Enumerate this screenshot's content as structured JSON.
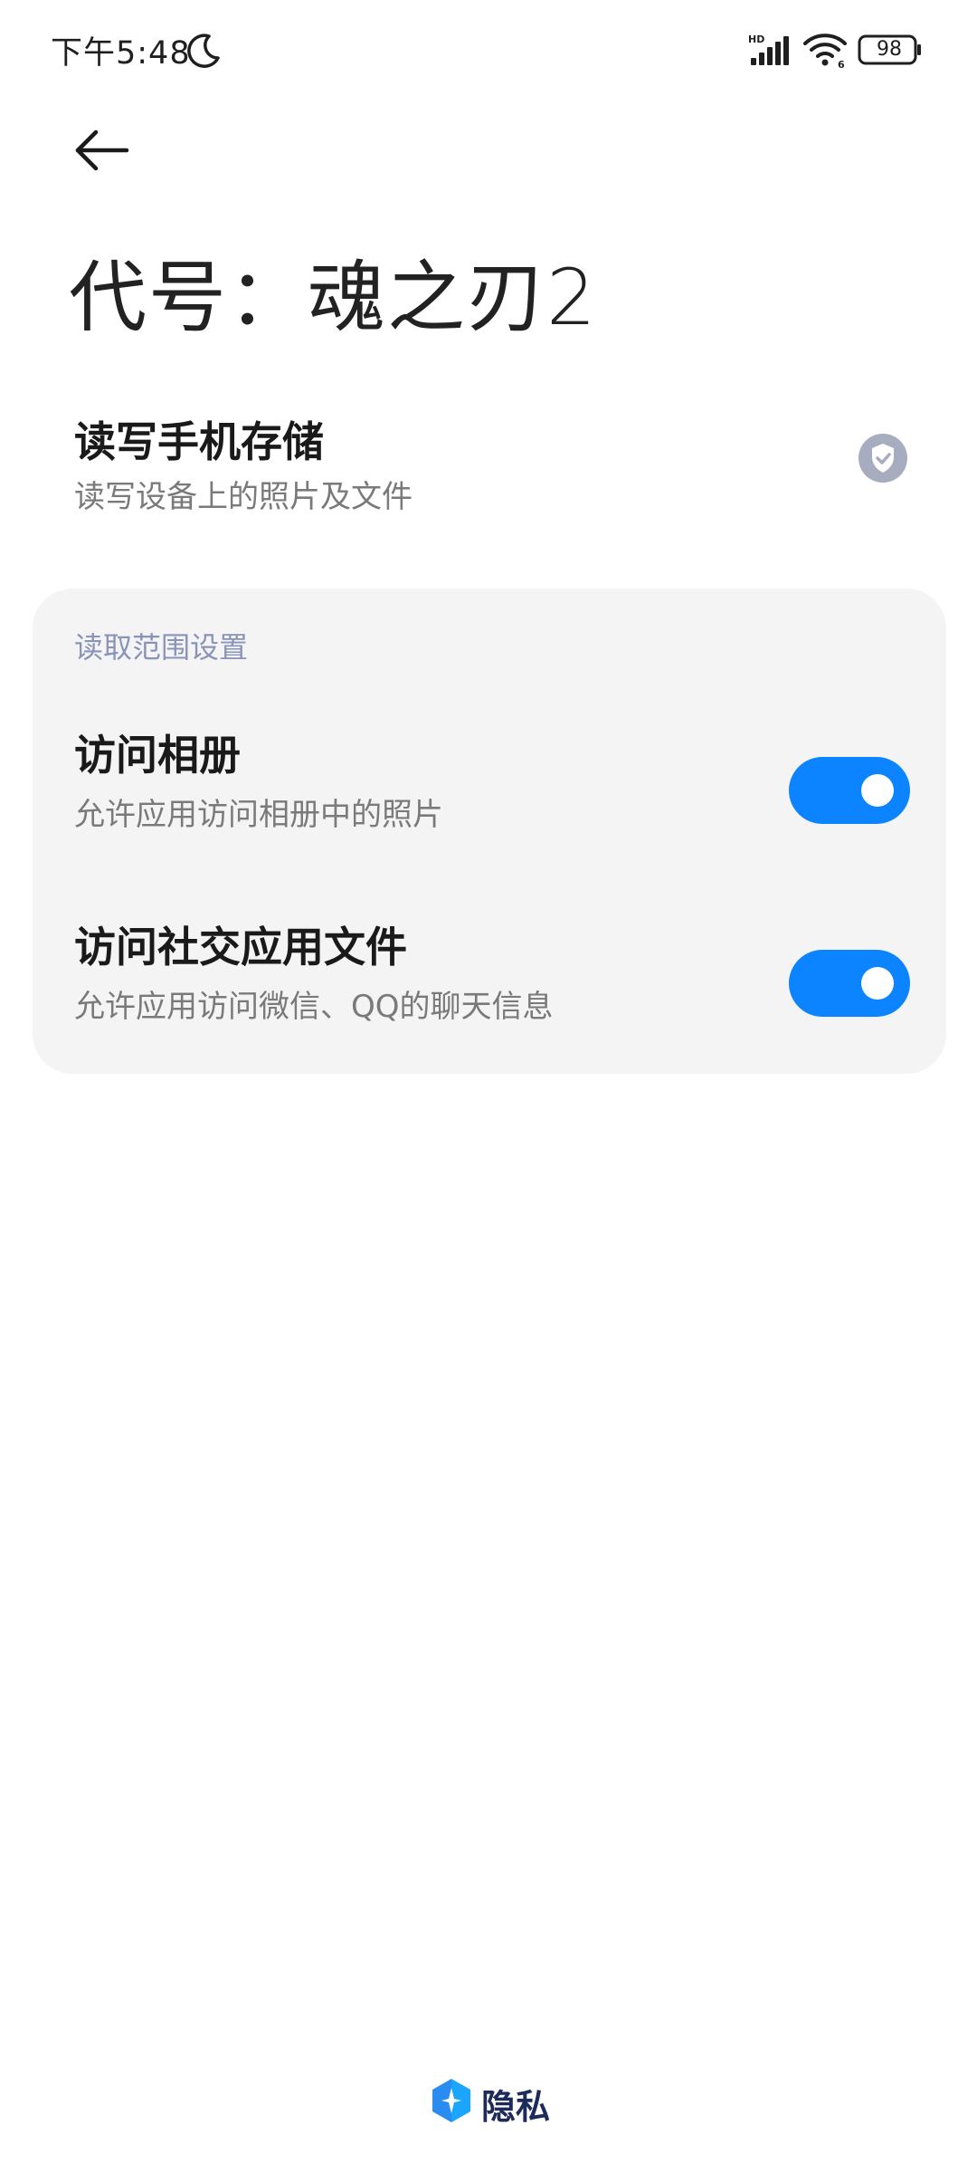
{
  "status_bar": {
    "time": "下午5:48",
    "battery": "98",
    "icons": [
      "moon-icon",
      "hd-signal-icon",
      "wifi-icon",
      "battery-icon"
    ]
  },
  "header": {
    "back_icon": "arrow-left-icon",
    "title": "代号：魂之刃2"
  },
  "storage_permission": {
    "title": "读写手机存储",
    "subtitle": "读写设备上的照片及文件",
    "status_icon": "shield-check-icon"
  },
  "scope_settings": {
    "header": "读取范围设置",
    "items": [
      {
        "title": "访问相册",
        "subtitle": "允许应用访问相册中的照片",
        "enabled": true
      },
      {
        "title": "访问社交应用文件",
        "subtitle": "允许应用访问微信、QQ的聊天信息",
        "enabled": true
      }
    ]
  },
  "footer": {
    "brand_icon": "privacy-shield-logo-icon",
    "brand_name": "隐私"
  },
  "colors": {
    "accent": "#0d84ff",
    "section_header": "#8a93b8",
    "card_bg": "#f4f4f4",
    "subtitle": "#7a7a7a"
  }
}
